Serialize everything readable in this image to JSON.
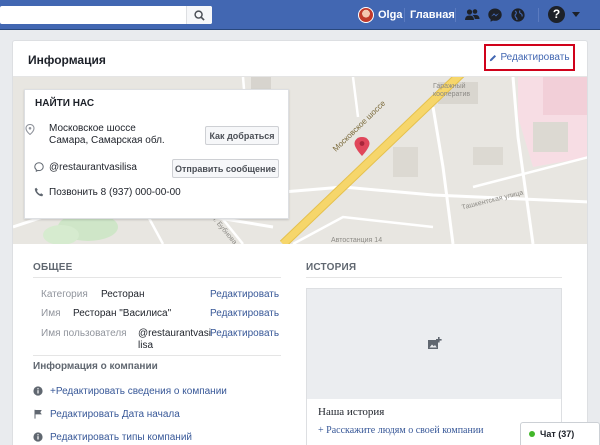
{
  "topbar": {
    "user_name": "Olga",
    "home_label": "Главная"
  },
  "page": {
    "section_title": "Информация",
    "edit_label": "Редактировать"
  },
  "map": {
    "street_main": "Московское шоссе",
    "street_east": "Ташкентская улица",
    "street_south": "Автостанция 14",
    "street_west": "ул. Бубнова",
    "place_gk": "Гаражный кооператив"
  },
  "find_us": {
    "title": "НАЙТИ НАС",
    "address_line1": "Московское шоссе",
    "address_line2": "Самара, Самарская обл.",
    "directions_button": "Как добраться",
    "username": "@restaurantvasilisa",
    "message_button": "Отправить сообщение",
    "phone": "Позвонить 8 (937) 000-00-00"
  },
  "general": {
    "title": "ОБЩЕЕ",
    "rows": [
      {
        "label": "Категория",
        "value": "Ресторан",
        "action": "Редактировать"
      },
      {
        "label": "Имя",
        "value": "Ресторан \"Василиса\"",
        "action": "Редактировать"
      },
      {
        "label": "Имя пользователя",
        "value_line1": "@restaurantvasi",
        "value_line2": "lisa",
        "action": "Редактировать"
      }
    ],
    "company_info_title": "Информация о компании",
    "company_links": [
      "+Редактировать сведения о компании",
      "Редактировать Дата начала",
      "Редактировать типы компаний"
    ]
  },
  "history": {
    "title": "ИСТОРИЯ",
    "heading": "Наша история",
    "link": "+ Расскажите людям о своей компании"
  },
  "chat": {
    "label": "Чат (37)"
  },
  "colors": {
    "brand": "#4267b2",
    "link": "#385898",
    "highlight_border": "#d0021b",
    "map_pin": "#e0475b",
    "road": "#f6d66b"
  }
}
